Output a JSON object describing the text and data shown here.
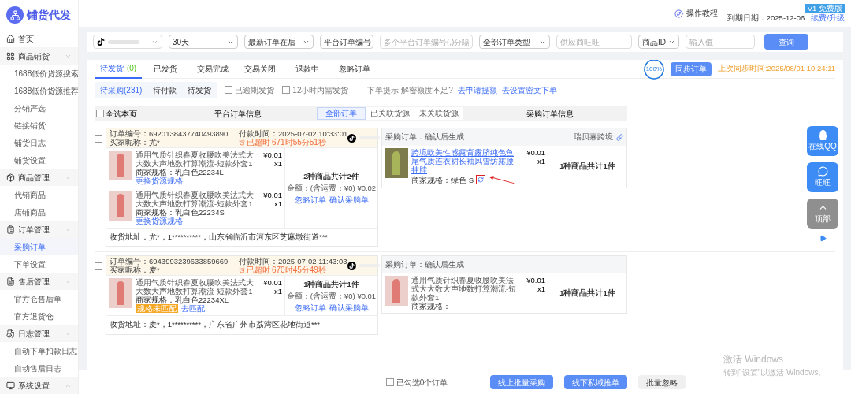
{
  "sidebar": {
    "logo": "铺货代发",
    "items": [
      {
        "label": "首页",
        "selected": false
      },
      {
        "label": "商品铺货",
        "expanded": true,
        "children": [
          {
            "label": "1688低价货源搜索",
            "selected": false
          },
          {
            "label": "1688低价货源推荐",
            "selected": false
          },
          {
            "label": "分销严选",
            "selected": false
          },
          {
            "label": "链接铺货",
            "selected": false
          },
          {
            "label": "铺货日志",
            "selected": false
          },
          {
            "label": "铺货设置",
            "selected": false
          }
        ]
      },
      {
        "label": "商品管理",
        "expanded": true,
        "children": [
          {
            "label": "代销商品",
            "selected": false
          },
          {
            "label": "店铺商品",
            "selected": false
          }
        ]
      },
      {
        "label": "订单管理",
        "expanded": true,
        "children": [
          {
            "label": "采购订单",
            "selected": true
          },
          {
            "label": "下单设置",
            "selected": false
          }
        ]
      },
      {
        "label": "售后管理",
        "expanded": true,
        "children": [
          {
            "label": "官方仓售后单",
            "selected": false
          },
          {
            "label": "官方退货仓",
            "selected": false
          }
        ]
      },
      {
        "label": "日志管理",
        "expanded": true,
        "children": [
          {
            "label": "自动下单扣款日志",
            "selected": false
          },
          {
            "label": "自动售后日志",
            "selected": false
          }
        ]
      },
      {
        "label": "系统设置",
        "expanded": false
      }
    ]
  },
  "header": {
    "help": "操作教程",
    "account_badge": "V1 免费版",
    "expiry": "到期日期：2025-12-06",
    "renew": "续费/升级"
  },
  "filters": [
    {
      "kind": "shop"
    },
    {
      "kind": "select",
      "value": "30天"
    },
    {
      "kind": "select",
      "value": "最新订单在后"
    },
    {
      "kind": "select",
      "value": "平台订单编号"
    },
    {
      "kind": "input",
      "placeholder": "多个平台订单编号(,)分隔"
    },
    {
      "kind": "select",
      "value": "全部订单类型"
    },
    {
      "kind": "input",
      "placeholder": "供应商旺旺"
    },
    {
      "kind": "select",
      "value": "商品ID"
    },
    {
      "kind": "input",
      "placeholder": "输入值"
    },
    {
      "kind": "button",
      "label": "查询"
    }
  ],
  "tabs": [
    {
      "label": "待发货",
      "count": "(0)",
      "selected": true
    },
    {
      "label": "已发货",
      "selected": false
    },
    {
      "label": "交易完成",
      "selected": false
    },
    {
      "label": "交易关闭",
      "selected": false
    },
    {
      "label": "退款中",
      "selected": false
    },
    {
      "label": "忽略订单",
      "selected": false
    }
  ],
  "sync": {
    "progress": "100%",
    "level": 1,
    "button": "同步订单",
    "last_sync": "上次同步时间:2025/08/01 10:24:11"
  },
  "subtabs": [
    {
      "label": "待采购(231)",
      "selected": true
    },
    {
      "label": "待付款",
      "selected": false
    },
    {
      "label": "待发货",
      "selected": false
    }
  ],
  "quick_filters": [
    {
      "label": "已逾期发货",
      "checked": false
    },
    {
      "label": "12小时内需发货",
      "checked": false
    }
  ],
  "tip": {
    "text": "下单提示 解密额度不足?",
    "links": [
      "去申请提额",
      "去设置密文下单"
    ]
  },
  "table_header": {
    "select_all": {
      "label": "全选本页",
      "checked": false
    },
    "platform_title": "平台订单信息",
    "filters": [
      {
        "label": "全部订单",
        "selected": true
      },
      {
        "label": "已关联货源",
        "selected": false
      },
      {
        "label": "未关联货源",
        "selected": false
      }
    ],
    "purchase_title": "采购订单信息"
  },
  "orders": [
    {
      "checked": false,
      "order_no": "订单编号：6920138437740493890",
      "pay_time": "付款时间：2025-07-02 10:33:01",
      "buyer": "买家昵称：尤*",
      "overdue_label": "已超时",
      "overdue_time": "671时55分51秒",
      "items": [
        {
          "title": "通用气质针织春夏收腰吹美法式大大数大声地数打算潮流-短款外套1",
          "price": "¥0.01",
          "qty": "x1",
          "spec": "商家规格：乳白色22234L",
          "action": "更换货源规格"
        },
        {
          "title": "通用气质针织春夏收腰吹美法式大大数大声地数打算潮流-短款外套1",
          "price": "¥0.01",
          "qty": "x1",
          "spec": "商家规格：乳白色22234S",
          "action": "更换货源规格"
        }
      ],
      "summary": {
        "count": "2种商品共计2件",
        "amount": "金额：(含运费：¥0) ¥0.02",
        "actions": [
          "忽略订单",
          "确认采购单"
        ]
      },
      "address": "收货地址：尤*，1**********，山东省临沂市河东区芝麻墩街道***",
      "purchase": {
        "status": "采购订单：确认后生成",
        "supplier": "瑞贝嘉跨境",
        "items": [
          {
            "title": "跨境欧美性感露背露脐纯色鱼尾气质连衣裙长袖风雪纺露腰挂脖",
            "linked": true,
            "price": "¥0.01",
            "qty": "x1",
            "spec": "商家规格：绿色 S",
            "refresh": true,
            "highlighted": true
          }
        ],
        "summary": "1种商品共计1件"
      }
    },
    {
      "checked": false,
      "order_no": "订单编号：6943993239633859669",
      "pay_time": "付款时间：2025-07-02 11:43:03",
      "buyer": "买家昵称：麦*",
      "overdue_label": "已超时",
      "overdue_time": "670时45分49秒",
      "items": [
        {
          "title": "通用气质针织春夏收腰吹美法式大大数大声地数打算潮流-短款外套1",
          "price": "¥0.01",
          "qty": "x1",
          "spec": "商家规格：乳白色22234XL",
          "badge": "规格未匹配",
          "action": "去匹配"
        }
      ],
      "summary": {
        "count": "1种商品共计1件",
        "amount": "金额：(含运费：¥0) ¥0.01",
        "actions": [
          "忽略订单",
          "确认采购单"
        ]
      },
      "address": "收货地址：麦*，1**********，广东省广州市荔湾区花地街道***",
      "purchase": {
        "status": "采购订单：确认后生成",
        "items": [
          {
            "title": "通用气质针织春夏收腰吹美法式大大数大声地数打算潮流-短款外套1",
            "linked": false,
            "price": "¥0.01",
            "qty": "x1",
            "spec": "商家规格：",
            "refresh": false,
            "highlighted": false
          }
        ],
        "summary": "1种商品共计1件"
      }
    }
  ],
  "footer": {
    "select": {
      "label": "已勾选0个订单",
      "checked": false
    },
    "buttons": [
      {
        "label": "线上批量采购",
        "kind": "primary"
      },
      {
        "label": "线下私域推单",
        "kind": "primary"
      },
      {
        "label": "批量忽略",
        "kind": "secondary"
      }
    ]
  },
  "float_buttons": [
    {
      "label": "在线QQ",
      "kind": "qq"
    },
    {
      "label": "旺旺",
      "kind": "wangwang"
    },
    {
      "label": "顶部",
      "kind": "top"
    }
  ],
  "os_notice": {
    "title": "激活 Windows",
    "subtitle": "转到\"设置\"以激活 Windows。"
  }
}
